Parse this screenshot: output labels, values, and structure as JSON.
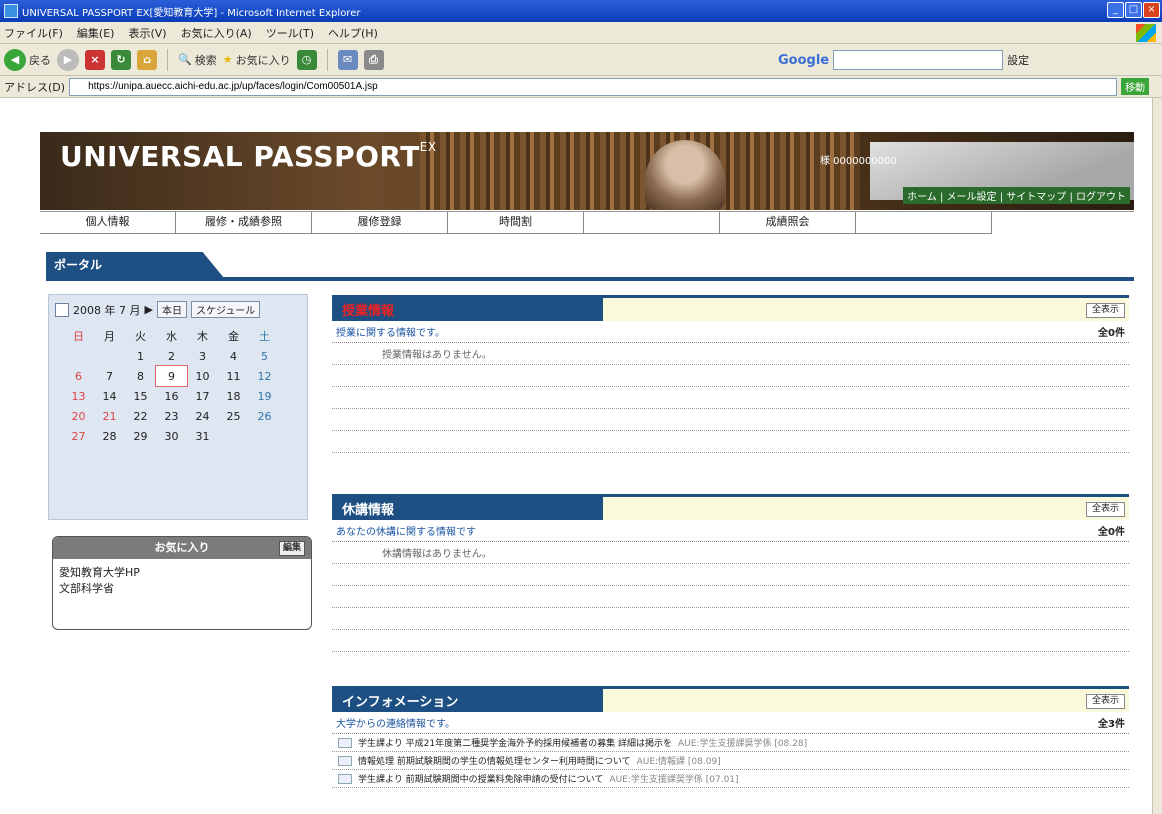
{
  "window": {
    "title": "UNIVERSAL PASSPORT EX[愛知教育大学] - Microsoft Internet Explorer"
  },
  "menu": [
    "ファイル(F)",
    "編集(E)",
    "表示(V)",
    "お気に入り(A)",
    "ツール(T)",
    "ヘルプ(H)"
  ],
  "toolbar": {
    "back": "戻る",
    "search": "検索",
    "favorites": "お気に入り",
    "google_logo": "Google",
    "settings": "設定"
  },
  "address": {
    "label": "アドレス(D)",
    "url": "https://unipa.auecc.aichi-edu.ac.jp/up/faces/login/Com00501A.jsp",
    "go": "移動"
  },
  "banner": {
    "logo": "UNIVERSAL PASSPORT",
    "logo_suffix": "EX",
    "user": "様 0000000000",
    "links": "ホーム | メール設定 | サイトマップ | ログアウト"
  },
  "nav": [
    "個人情報",
    "履修・成績参照",
    "履修登録",
    "時間割",
    "",
    "成績照会",
    ""
  ],
  "portal_tab": "ポータル",
  "calendar": {
    "title": "2008 年 7 月",
    "today_btn": "本日",
    "schedule_btn": "スケジュール",
    "weekdays": [
      "日",
      "月",
      "火",
      "水",
      "木",
      "金",
      "土"
    ],
    "weeks": [
      [
        "",
        "",
        "1",
        "2",
        "3",
        "4",
        "5"
      ],
      [
        "6",
        "7",
        "8",
        "9",
        "10",
        "11",
        "12"
      ],
      [
        "13",
        "14",
        "15",
        "16",
        "17",
        "18",
        "19"
      ],
      [
        "20",
        "21",
        "22",
        "23",
        "24",
        "25",
        "26"
      ],
      [
        "27",
        "28",
        "29",
        "30",
        "31",
        "",
        ""
      ]
    ],
    "today": "9"
  },
  "favorites": {
    "title": "お気に入り",
    "edit": "編集",
    "items": [
      "愛知教育大学HP",
      "文部科学省"
    ]
  },
  "panels": [
    {
      "title": "授業情報",
      "title_color": "red",
      "button": "全表示",
      "desc": "授業に関する情報です。",
      "count": "全0件",
      "empty": "授業情報はありません。"
    },
    {
      "title": "休講情報",
      "title_color": "white",
      "button": "全表示",
      "desc": "あなたの休講に関する情報です",
      "count": "全0件",
      "empty": "休講情報はありません。"
    }
  ],
  "info": {
    "title": "インフォメーション",
    "button": "全表示",
    "desc": "大学からの連絡情報です。",
    "count": "全3件",
    "items": [
      {
        "text": "学生課より 平成21年度第二種奨学金海外予約採用候補者の募集 詳細は掲示を",
        "src": "AUE:学生支援課奨学係 [08.28]"
      },
      {
        "text": "情報処理 前期試験期間の学生の情報処理センター利用時間について",
        "src": "AUE:情報課 [08.09]"
      },
      {
        "text": "学生課より 前期試験期間中の授業料免除申請の受付について",
        "src": "AUE:学生支援課奨学係 [07.01]"
      }
    ]
  }
}
